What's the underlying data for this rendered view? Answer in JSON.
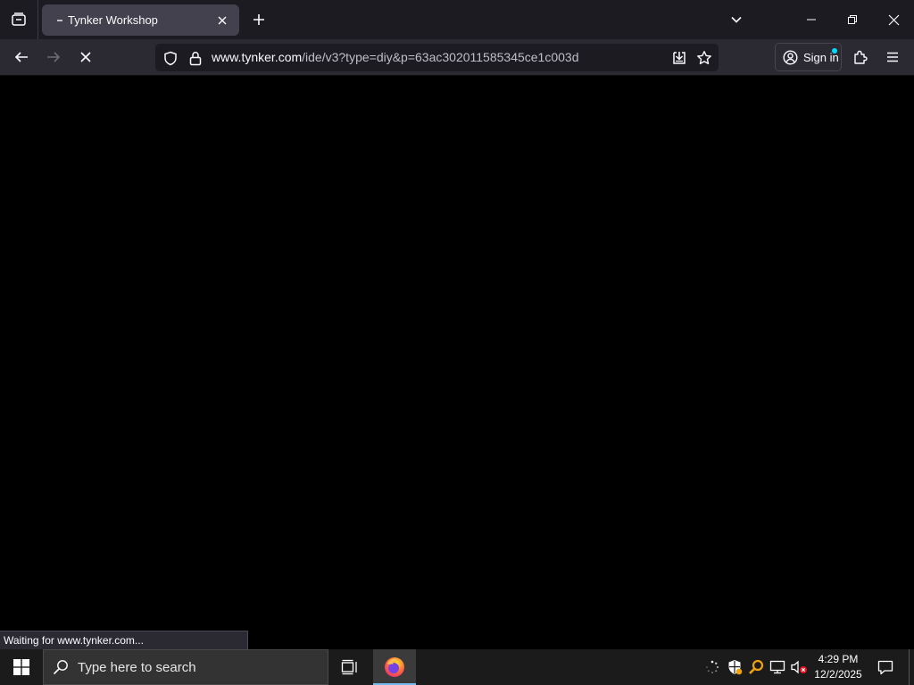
{
  "browser": {
    "tab": {
      "title": "Tynker Workshop"
    },
    "url": {
      "domain": "www.tynker.com",
      "path": "/ide/v3?type=diy&p=63ac302011585345ce1c003d"
    },
    "account": {
      "sign_in_label": "Sign in"
    },
    "status_text": "Waiting for www.tynker.com..."
  },
  "taskbar": {
    "search_placeholder": "Type here to search",
    "clock": {
      "time": "4:29 PM",
      "date": "12/2/2025"
    }
  },
  "icons": {
    "tab_manager": "tab-manager-icon",
    "close_tab": "close-icon",
    "new_tab": "plus-icon",
    "list_all_tabs": "chevron-down-icon",
    "back": "back-arrow-icon",
    "forward": "forward-arrow-icon",
    "stop": "stop-icon",
    "tracking_protection": "shield-icon",
    "secure": "lock-icon",
    "save_to_pocket": "download-icon",
    "bookmark": "star-icon",
    "account": "account-icon",
    "extensions": "puzzle-icon",
    "menu": "hamburger-menu-icon",
    "windows_start": "windows-logo-icon",
    "search": "search-icon",
    "task_view": "task-view-icon",
    "firefox": "firefox-icon"
  },
  "colors": {
    "tabstrip_bg": "#1c1b22",
    "toolbar_bg": "#2b2a33",
    "urlbar_bg": "#1c1b22",
    "active_tab_bg": "#42414d",
    "taskbar_bg": "#1b1b1b",
    "accent_dot": "#00ddff",
    "tray_orange": "#f0a30a"
  }
}
